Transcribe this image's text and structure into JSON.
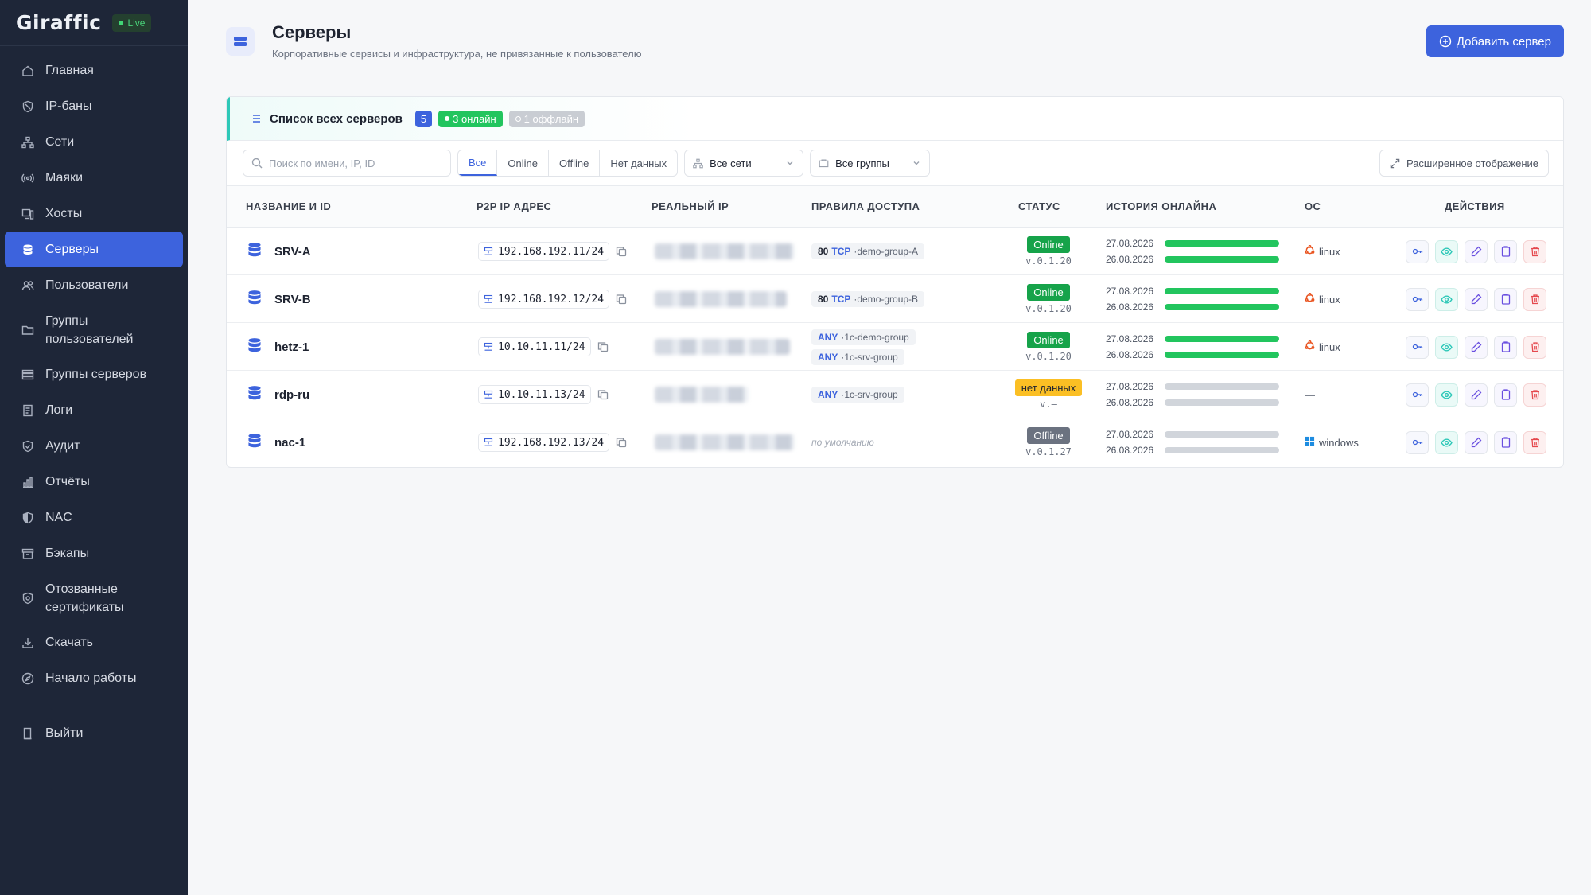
{
  "sidebar": {
    "logo": "Giraffic",
    "live": "Live",
    "items": [
      {
        "label": "Главная",
        "icon": "home-icon"
      },
      {
        "label": "IP-баны",
        "icon": "shield-ban-icon"
      },
      {
        "label": "Сети",
        "icon": "network-icon"
      },
      {
        "label": "Маяки",
        "icon": "beacon-icon"
      },
      {
        "label": "Хосты",
        "icon": "hosts-icon"
      },
      {
        "label": "Серверы",
        "icon": "database-icon",
        "active": true
      },
      {
        "label": "Пользователи",
        "icon": "users-icon"
      },
      {
        "label": "Группы пользователей",
        "icon": "folder-icon"
      },
      {
        "label": "Группы серверов",
        "icon": "server-stack-icon"
      },
      {
        "label": "Логи",
        "icon": "log-icon"
      },
      {
        "label": "Аудит",
        "icon": "audit-shield-icon"
      },
      {
        "label": "Отчёты",
        "icon": "chart-icon"
      },
      {
        "label": "NAC",
        "icon": "nac-shield-icon"
      },
      {
        "label": "Бэкапы",
        "icon": "archive-icon"
      },
      {
        "label": "Отозванные сертификаты",
        "icon": "revoked-cert-icon"
      },
      {
        "label": "Скачать",
        "icon": "download-icon"
      },
      {
        "label": "Начало работы",
        "icon": "compass-icon"
      }
    ],
    "logout": "Выйти"
  },
  "header": {
    "title": "Серверы",
    "subtitle": "Корпоративные сервисы и инфраструктура, не привязанные к пользователю",
    "add_button": "Добавить сервер"
  },
  "card": {
    "title": "Список всех серверов",
    "count": "5",
    "online": "3 онлайн",
    "offline": "1 оффлайн"
  },
  "toolbar": {
    "search_placeholder": "Поиск по имени, IP, ID",
    "filters": [
      "Все",
      "Online",
      "Offline",
      "Нет данных"
    ],
    "networks": "Все сети",
    "groups": "Все группы",
    "expand": "Расширенное отображение"
  },
  "table": {
    "columns": [
      "НАЗВАНИЕ И ID",
      "P2P IP АДРЕС",
      "РЕАЛЬНЫЙ IP",
      "ПРАВИЛА ДОСТУПА",
      "СТАТУС",
      "ИСТОРИЯ ОНЛАЙНА",
      "ОС",
      "ДЕЙСТВИЯ"
    ],
    "rows": [
      {
        "name": "SRV-A",
        "p2p": "192.168.192.11/24",
        "rules": [
          {
            "port": "80",
            "proto": "TCP",
            "group": "·demo-group-A"
          }
        ],
        "status": "Online",
        "version": "v.0.1.20",
        "hist": [
          "27.08.2026",
          "26.08.2026"
        ],
        "os": "linux"
      },
      {
        "name": "SRV-B",
        "p2p": "192.168.192.12/24",
        "rules": [
          {
            "port": "80",
            "proto": "TCP",
            "group": "·demo-group-B"
          }
        ],
        "status": "Online",
        "version": "v.0.1.20",
        "hist": [
          "27.08.2026",
          "26.08.2026"
        ],
        "os": "linux"
      },
      {
        "name": "hetz-1",
        "p2p": "10.10.11.11/24",
        "rules": [
          {
            "port": "",
            "proto": "ANY",
            "group": "·1c-demo-group"
          },
          {
            "port": "",
            "proto": "ANY",
            "group": "·1c-srv-group"
          }
        ],
        "status": "Online",
        "version": "v.0.1.20",
        "hist": [
          "27.08.2026",
          "26.08.2026"
        ],
        "os": "linux"
      },
      {
        "name": "rdp-ru",
        "p2p": "10.10.11.13/24",
        "rules": [
          {
            "port": "",
            "proto": "ANY",
            "group": "·1c-srv-group"
          }
        ],
        "status": "нет данных",
        "version": "v.–",
        "hist": [
          "27.08.2026",
          "26.08.2026"
        ],
        "os": "—"
      },
      {
        "name": "nac-1",
        "p2p": "192.168.192.13/24",
        "rules_default": "по умолчанию",
        "status": "Offline",
        "version": "v.0.1.27",
        "hist": [
          "27.08.2026",
          "26.08.2026"
        ],
        "os": "windows"
      }
    ]
  },
  "colors": {
    "accent": "#3d63dd",
    "online": "#16a34a",
    "nodata": "#fbbf24",
    "offline": "#6b7280",
    "teal": "#2ec8b8"
  }
}
